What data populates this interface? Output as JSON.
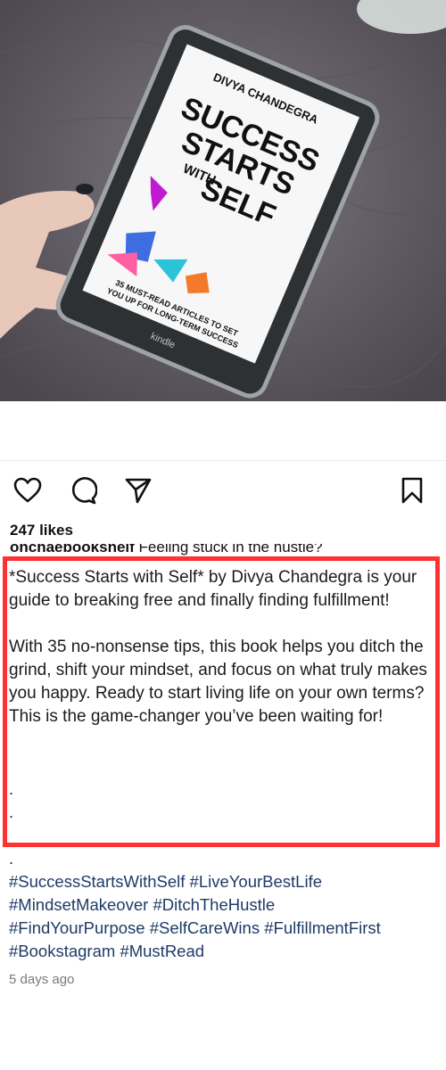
{
  "post": {
    "cover": {
      "author": "DIVYA CHANDEGRA",
      "title_line1": "SUCCESS",
      "title_line2": "STARTS",
      "title_line3": "WITH",
      "title_line4": "SELF",
      "subtitle_line1": "35 MUST-READ ARTICLES TO SET",
      "subtitle_line2": "YOU UP FOR LONG-TERM SUCCESS",
      "device_brand": "kindle"
    },
    "actions": {
      "like_icon": "heart-icon",
      "comment_icon": "comment-bubble-icon",
      "share_icon": "paper-plane-icon",
      "save_icon": "bookmark-icon"
    },
    "likes": "247 likes",
    "cut_username": "onchaebookshelf",
    "cut_text": "Feeling stuck in the hustle?",
    "caption": {
      "line1": "*Success Starts with Self* by Divya Chandegra is your guide to breaking free and finally finding fulfillment!",
      "line2": "With 35 no-nonsense tips, this book helps you ditch the grind, shift your mindset, and focus on what truly makes you happy. Ready to start living life on your own terms? This is the game-changer you’ve been waiting for!",
      "dot": "."
    },
    "hashtags": [
      "#SuccessStartsWithSelf",
      "#LiveYourBestLife",
      "#MindsetMakeover",
      "#DitchTheHustle",
      "#FindYourPurpose",
      "#SelfCareWins",
      "#FulfillmentFirst",
      "#Bookstagram",
      "#MustRead"
    ],
    "timestamp": "5 days ago",
    "colors": {
      "highlight": "#ff3131",
      "hashtag": "#1f3b67",
      "timestamp": "#7a7a7a"
    }
  }
}
